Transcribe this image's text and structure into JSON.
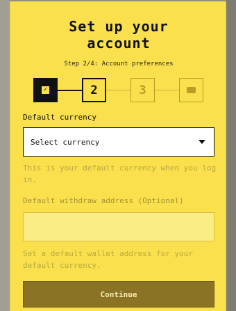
{
  "title": "Set up your\naccount",
  "step_label": "Step 2/4: Account preferences",
  "stepper": {
    "steps": [
      {
        "label": "",
        "state": "done",
        "icon": "check-icon"
      },
      {
        "label": "2",
        "state": "active"
      },
      {
        "label": "3",
        "state": "inactive"
      },
      {
        "label": "",
        "state": "inactive",
        "icon": "wallet-icon"
      }
    ]
  },
  "currency": {
    "label": "Default currency",
    "placeholder": "Select currency",
    "help": "This is your default currency when you log in."
  },
  "address": {
    "label": "Default withdraw address (Optional)",
    "value": "",
    "help": "Set a default wallet address for your default currency."
  },
  "continue_label": "Continue",
  "colors": {
    "background": "#fae04d",
    "primary_text": "#111111",
    "muted_text": "#b9a83e",
    "button": "#8a7325"
  }
}
